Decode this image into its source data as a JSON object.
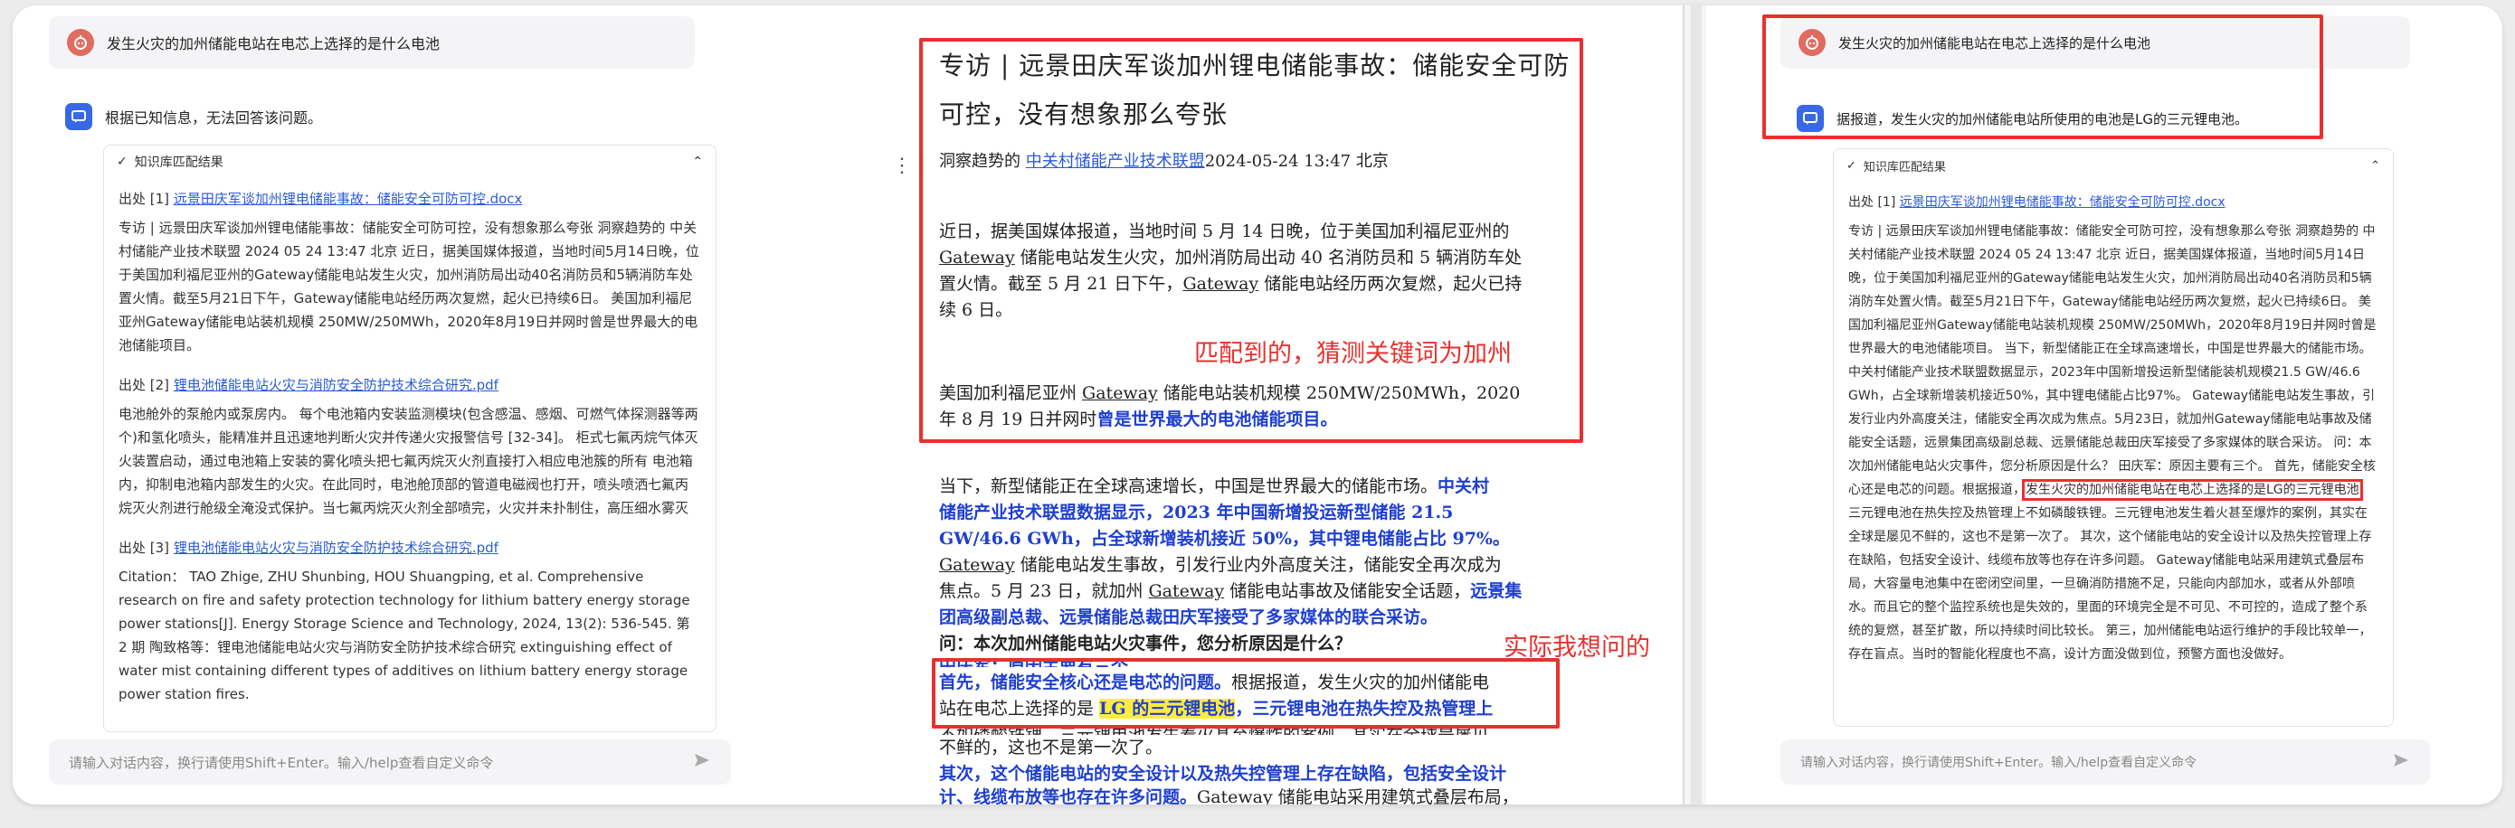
{
  "question": "发生火灾的加州储能电站在电芯上选择的是什么电池",
  "left": {
    "answer": "根据已知信息，无法回答该问题。",
    "kb_header": "知识库匹配结果",
    "src1_prefix": "出处 [1]",
    "src1_link": "远景田庆军谈加州锂电储能事故：储能安全可防可控.docx",
    "src1_text": "专访 | 远景田庆军谈加州锂电储能事故：储能安全可防可控，没有想象那么夸张 洞察趋势的 中关村储能产业技术联盟 2024 05 24 13:47 北京 近日，据美国媒体报道，当地时间5月14日晚，位于美国加利福尼亚州的Gateway储能电站发生火灾，加州消防局出动40名消防员和5辆消防车处置火情。截至5月21日下午，Gateway储能电站经历两次复燃，起火已持续6日。 美国加利福尼亚州Gateway储能电站装机规模 250MW/250MWh，2020年8月19日并网时曾是世界最大的电池储能项目。",
    "src2_prefix": "出处 [2]",
    "src2_link": "锂电池储能电站火灾与消防安全防护技术综合研究.pdf",
    "src2_text": "电池舱外的泵舱内或泵房内。 每个电池箱内安装监测模块(包含感温、感烟、可燃气体探测器等两个)和氢化喷头，能精准并且迅速地判断火灾并传递火灾报警信号 [32-34]。 柜式七氟丙烷气体灭火装置启动，通过电池箱上安装的雾化喷头把七氟丙烷灭火剂直接打入相应电池簇的所有 电池箱内，抑制电池箱内部发生的火灾。在此同时，电池舱顶部的管道电磁阀也打开，喷头喷洒七氟丙烷灭火剂进行舱级全淹没式保护。当七氟丙烷灭火剂全部喷完，火灾并未扑制住，高压细水雾灭",
    "src3_prefix": "出处 [3]",
    "src3_link": "锂电池储能电站火灾与消防安全防护技术综合研究.pdf",
    "src3_text": "Citation： TAO Zhige, ZHU Shunbing, HOU Shuangping, et al. Comprehensive research on fire and safety protection technology for lithium battery energy storage power stations[J]. Energy Storage Science and Technology, 2024, 13(2): 536-545. 第 2 期 陶致格等：锂电池储能电站火灾与消防安全防护技术综合研究 extinguishing effect of water mist containing different types of additives on lithium battery energy storage power station fires.",
    "input_placeholder": "请输入对话内容，换行请使用Shift+Enter。输入/help查看自定义命令"
  },
  "middle": {
    "title": "专访 | 远景田庆军谈加州锂电储能事故：储能安全可防可控，没有想象那么夸张",
    "byline_prefix": "洞察趋势的",
    "byline_link": "中关村储能产业技术联盟",
    "byline_suffix": "2024-05-24 13:47 北京",
    "p1_l1": "近日，据美国媒体报道，当地时间 5 月 14 日晚，位于美国加利福尼亚州的",
    "p1_l2a": "Gateway",
    "p1_l2b": " 储能电站发生火灾，加州消防局出动 40 名消防员和 5 辆消防车处",
    "p1_l3a": "置火情。截至 5 月 21 日下午，",
    "p1_l3b": "Gateway",
    "p1_l3c": " 储能电站经历两次复燃，起火已持",
    "p1_l4": "续 6 日。",
    "p2_l1a": "美国加利福尼亚州 ",
    "p2_l1b": "Gateway",
    "p2_l1c": " 储能电站装机规模  250MW/250MWh，2020",
    "p2_l2a": "年 8 月 19 日并网时",
    "p2_l2b": "曾是世界最大的电池储能项目。",
    "annot1": "匹配到的，猜测关键词为加州",
    "p3_l1a": "当下，新型储能正在全球高速增长，中国是世界最大的储能市场。",
    "p3_l1b": "中关村",
    "p3_l2": "储能产业技术联盟数据显示，2023 年中国新增投运新型储能 21.5",
    "p3_l3": "GW/46.6 GWh，占全球新增装机接近 50%，其中锂电储能占比 97%。",
    "p3_l4a": "Gateway",
    "p3_l4b": " 储能电站发生事故，引发行业内外高度关注，储能安全再次成为",
    "p3_l5a": "焦点。5 月 23 日，就加州 ",
    "p3_l5b": "Gateway",
    "p3_l5c": " 储能电站事故及储能安全话题，",
    "p3_l5d": "远景集",
    "p3_l6": "团高级副总裁、远景储能总裁田庆军接受了多家媒体的联合采访。",
    "q_line": "问：本次加州储能电站火灾事件，您分析原因是什么？",
    "q_line2": "田庆军：原因主要有三个。",
    "annot2": "实际我想问的",
    "p4_l1a": "首先，储能安全核心还是电芯的问题。",
    "p4_l1b": "根据报道，发生火灾的加州储能电",
    "p4_l2a": "站在电芯上选择的是 ",
    "p4_l2b": "LG 的三元锂电池",
    "p4_l2c": "，三元锂电池在热失控及热管理上",
    "p4_l3": "不如磷酸铁锂。三元锂电池发生着火甚至爆炸的案例，其实在全球是屡见",
    "p4_l4": "不鲜的，这也不是第一次了。",
    "p5_l1": "其次，这个储能电站的安全设计以及热失控管理上存在缺陷，包括安全设计",
    "p5_l2a": "计、线缆布放等也存在许多问题。",
    "p5_l2b": "Gateway 储能电站采用建筑式叠层布局，"
  },
  "right": {
    "answer": "据报道，发生火灾的加州储能电站所使用的电池是LG的三元锂电池。",
    "kb_header": "知识库匹配结果",
    "src1_prefix": "出处 [1]",
    "src1_link": "远景田庆军谈加州锂电储能事故：储能安全可防可控.docx",
    "body_a": "专访 | 远景田庆军谈加州锂电储能事故：储能安全可防可控，没有想象那么夸张 洞察趋势的 中关村储能产业技术联盟 2024 05 24 13:47 北京 近日，据美国媒体报道，当地时间5月14日晚，位于美国加利福尼亚州的Gateway储能电站发生火灾，加州消防局出动40名消防员和5辆消防车处置火情。截至5月21日下午，Gateway储能电站经历两次复燃，起火已持续6日。 美国加利福尼亚州Gateway储能电站装机规模 250MW/250MWh，2020年8月19日并网时曾是世界最大的电池储能项目。 当下，新型储能正在全球高速增长，中国是世界最大的储能市场。 中关村储能产业技术联盟数据显示，2023年中国新增投运新型储能装机规模21.5 GW/46.6 GWh，占全球新增装机接近50%，其中锂电储能占比97%。 Gateway储能电站发生事故，引发行业内外高度关注，储能安全再次成为焦点。5月23日，就加州Gateway储能电站事故及储能安全话题，远景集团高级副总裁、远景储能总裁田庆军接受了多家媒体的联合采访。 问：本次加州储能电站火灾事件，您分析原因是什么？ 田庆军：原因主要有三个。 首先，储能安全核心还是电芯的问题。根据报道，",
    "body_hl": "发生火灾的加州储能电站在电芯上选择的是LG的三元锂电池",
    "body_b": "，三元锂电池在热失控及热管理上不如磷酸铁锂。三元锂电池发生着火甚至爆炸的案例，其实在全球是屡见不鲜的，这也不是第一次了。 其次，这个储能电站的安全设计以及热失控管理上存在缺陷，包括安全设计、线缆布放等也存在许多问题。 Gateway储能电站采用建筑式叠层布局，大容量电池集中在密闭空间里，一旦确消防措施不足，只能向内部加水，或者从外部喷水。而且它的整个监控系统也是失效的，里面的环境完全是不可见、不可控的，造成了整个系统的复燃，甚至扩散，所以持续时间比较长。 第三，加州储能电站运行维护的手段比较单一，存在盲点。当时的智能化程度也不高，设计方面没做到位，预警方面也没做好。",
    "input_placeholder": "请输入对话内容，换行请使用Shift+Enter。输入/help查看自定义命令"
  },
  "colors": {
    "red": "#e8312f",
    "blue_text": "#1e3fd0",
    "link": "#2a5bd7",
    "highlight": "#ffec3d"
  },
  "icons": {
    "user": "robot-face-icon",
    "assistant": "chat-bubble-icon",
    "check": "check-icon",
    "chevron": "chevron-up-icon",
    "send": "send-icon",
    "grip": "drag-handle-icon"
  }
}
